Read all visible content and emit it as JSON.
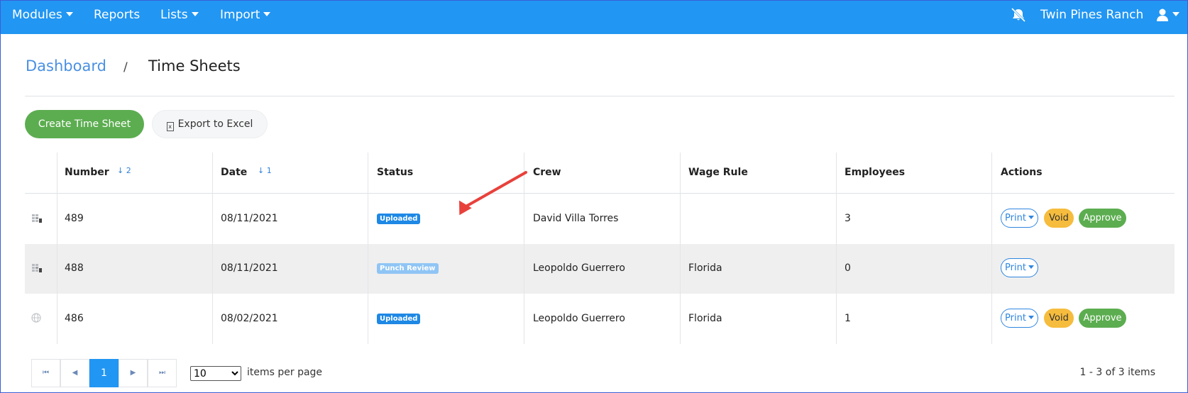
{
  "nav": {
    "modules": "Modules",
    "reports": "Reports",
    "lists": "Lists",
    "import": "Import",
    "company": "Twin Pines Ranch",
    "notifications_icon": "bell-slash-icon",
    "user_icon": "user-icon"
  },
  "breadcrumb": {
    "dashboard": "Dashboard",
    "separator": "/",
    "current": "Time Sheets"
  },
  "toolbar": {
    "create_label": "Create Time Sheet",
    "export_label": "Export to Excel",
    "export_icon": "excel-file-icon"
  },
  "table": {
    "columns": [
      "Number",
      "Date",
      "Status",
      "Crew",
      "Wage Rule",
      "Employees",
      "Actions"
    ],
    "sort_number": "↓ 2",
    "sort_date": "↓ 1",
    "rows": [
      {
        "icon": "grid-icon",
        "number": "489",
        "date": "08/11/2021",
        "status": "Uploaded",
        "crew": "David Villa Torres",
        "wage_rule": "",
        "employees": "3",
        "actions": [
          "Print",
          "Void",
          "Approve"
        ]
      },
      {
        "icon": "grid-icon",
        "number": "488",
        "date": "08/11/2021",
        "status": "Punch Review",
        "crew": "Leopoldo Guerrero",
        "wage_rule": "Florida",
        "employees": "0",
        "actions": [
          "Print"
        ]
      },
      {
        "icon": "globe-icon",
        "number": "486",
        "date": "08/02/2021",
        "status": "Uploaded",
        "crew": "Leopoldo Guerrero",
        "wage_rule": "Florida",
        "employees": "1",
        "actions": [
          "Print",
          "Void",
          "Approve"
        ]
      }
    ]
  },
  "pager": {
    "first": "⏮",
    "prev": "◀",
    "current_page": "1",
    "next": "▶",
    "last": "⏭",
    "per_page_value": "10",
    "per_page_label": "items per page",
    "summary": "1 - 3 of 3 items"
  },
  "colors": {
    "nav_bg": "#2196f3",
    "primary": "#2196f3",
    "success": "#5cad50",
    "warning": "#f6bc3d",
    "annotation_arrow": "#e8413b"
  }
}
